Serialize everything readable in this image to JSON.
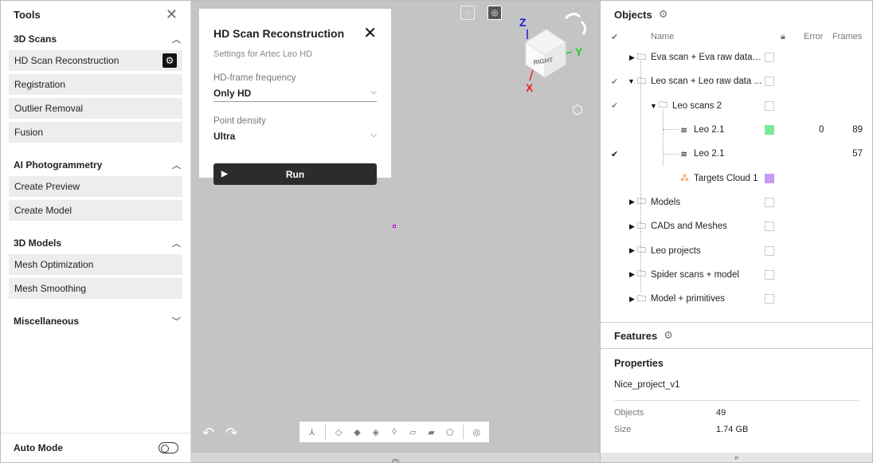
{
  "left": {
    "title": "Tools",
    "sections": [
      {
        "title": "3D Scans",
        "items": [
          "HD Scan Reconstruction",
          "Registration",
          "Outlier Removal",
          "Fusion"
        ]
      },
      {
        "title": "AI Photogrammetry",
        "items": [
          "Create Preview",
          "Create Model"
        ]
      },
      {
        "title": "3D Models",
        "items": [
          "Mesh Optimization",
          "Mesh Smoothing"
        ]
      },
      {
        "title": "Miscellaneous",
        "items": []
      }
    ],
    "auto_mode": "Auto Mode"
  },
  "dialog": {
    "title": "HD Scan Reconstruction",
    "subtitle": "Settings for Artec Leo HD",
    "field1_label": "HD-frame frequency",
    "field1_value": "Only HD",
    "field2_label": "Point density",
    "field2_value": "Ultra",
    "run": "Run"
  },
  "cube": {
    "face": "RIGHT",
    "z": "Z",
    "y": "Y",
    "x": "X"
  },
  "right": {
    "title": "Objects",
    "cols": {
      "name": "Name",
      "error": "Error",
      "frames": "Frames"
    },
    "rows": [
      {
        "name": "Eva scan + Eva raw data ...",
        "type": "folder",
        "err": "",
        "frames": ""
      },
      {
        "name": "Leo scan + Leo raw data ...",
        "type": "folder-open",
        "err": "",
        "frames": ""
      },
      {
        "name": "Leo scans 2",
        "type": "folder-open",
        "err": "",
        "frames": ""
      },
      {
        "name": "Leo 2.1",
        "type": "scan",
        "err": "0",
        "frames": "89"
      },
      {
        "name": "Leo 2.1",
        "type": "scan-raw",
        "err": "",
        "frames": "57"
      },
      {
        "name": "Targets Cloud 1",
        "type": "targets",
        "err": "",
        "frames": ""
      },
      {
        "name": "Models",
        "type": "folder",
        "err": "",
        "frames": ""
      },
      {
        "name": "CADs and Meshes",
        "type": "folder",
        "err": "",
        "frames": ""
      },
      {
        "name": "Leo projects",
        "type": "folder",
        "err": "",
        "frames": ""
      },
      {
        "name": "Spider scans + model",
        "type": "folder",
        "err": "",
        "frames": ""
      },
      {
        "name": "Model + primitives",
        "type": "folder",
        "err": "",
        "frames": ""
      }
    ],
    "features": "Features",
    "properties": {
      "title": "Properties",
      "project": "Nice_project_v1",
      "objects_label": "Objects",
      "objects_value": "49",
      "size_label": "Size",
      "size_value": "1.74 GB"
    }
  },
  "colors": {
    "green": "#7ee89a",
    "purple": "#c89af0",
    "dark": "#2c2c2c"
  }
}
